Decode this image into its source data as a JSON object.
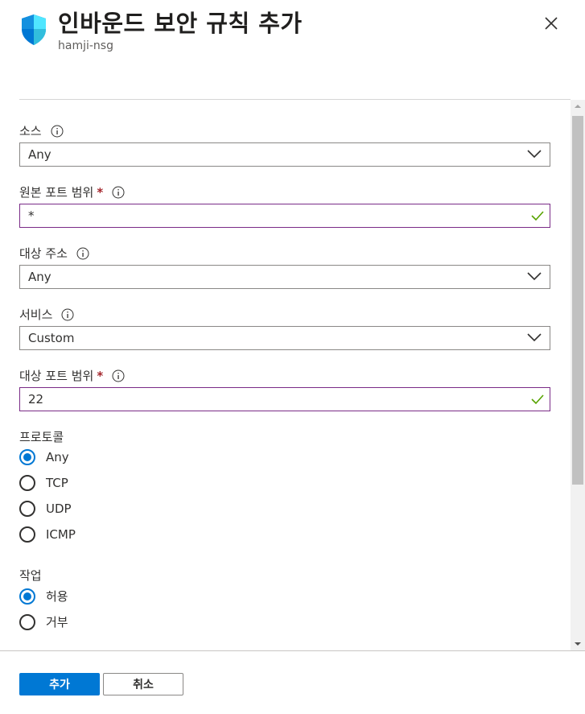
{
  "header": {
    "title": "인바운드 보안 규칙 추가",
    "subtitle": "hamji-nsg",
    "icon": "shield-icon",
    "close_icon": "close-icon"
  },
  "form": {
    "source": {
      "label": "소스",
      "value": "Any"
    },
    "source_port": {
      "label": "원본 포트 범위",
      "required": "*",
      "value": "*"
    },
    "destination": {
      "label": "대상 주소",
      "value": "Any"
    },
    "service": {
      "label": "서비스",
      "value": "Custom"
    },
    "dest_port": {
      "label": "대상 포트 범위",
      "required": "*",
      "value": "22"
    },
    "protocol": {
      "label": "프로토콜",
      "options": [
        "Any",
        "TCP",
        "UDP",
        "ICMP"
      ],
      "selected": "Any"
    },
    "action": {
      "label": "작업",
      "options": [
        "허용",
        "거부"
      ],
      "selected": "허용"
    }
  },
  "footer": {
    "add_label": "추가",
    "cancel_label": "취소"
  },
  "colors": {
    "accent": "#0078d4",
    "valid_input_border": "#7a2b87",
    "valid_check": "#57a300",
    "required": "#a4262c",
    "shield_light": "#50e6ff",
    "shield_dark": "#0078d4"
  }
}
